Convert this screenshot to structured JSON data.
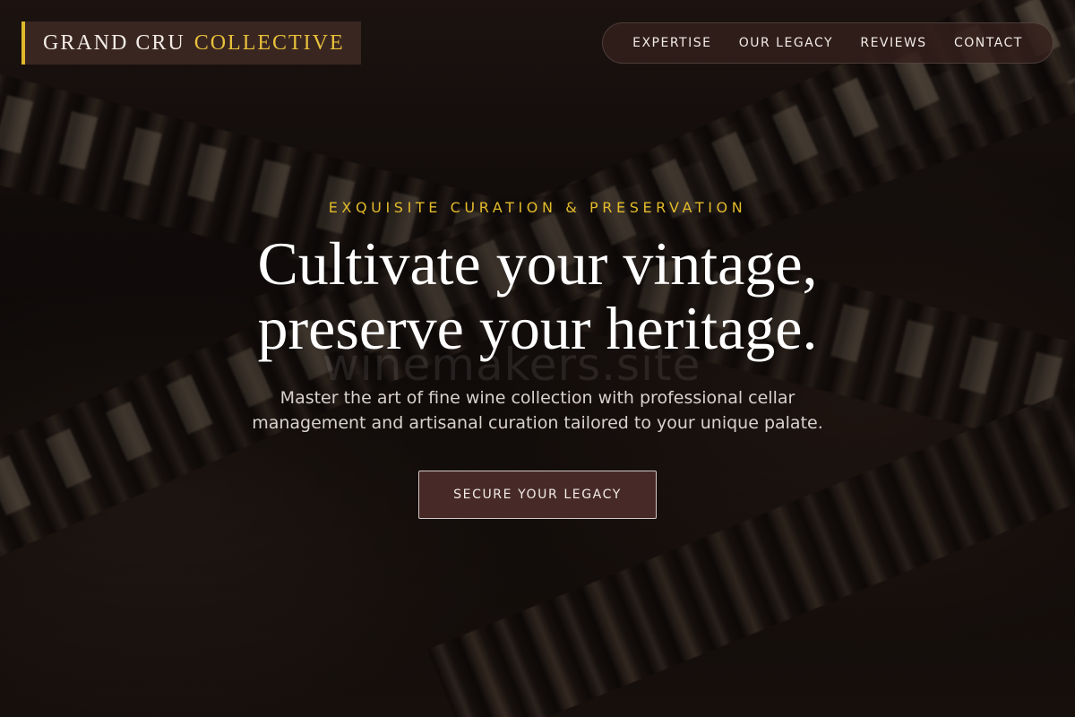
{
  "brand": {
    "name_main": "GRAND CRU",
    "name_accent": "COLLECTIVE",
    "accent_color": "#e8c13a"
  },
  "nav": {
    "items": [
      {
        "label": "EXPERTISE"
      },
      {
        "label": "OUR LEGACY"
      },
      {
        "label": "REVIEWS"
      },
      {
        "label": "CONTACT"
      }
    ]
  },
  "hero": {
    "eyebrow": "EXQUISITE CURATION & PRESERVATION",
    "headline_line1": "Cultivate your vintage,",
    "headline_line2": "preserve your heritage.",
    "subtext": "Master the art of fine wine collection with professional cellar management and artisanal curation tailored to your unique palate.",
    "cta_label": "SECURE YOUR LEGACY",
    "watermark": "winemakers.site"
  },
  "colors": {
    "gold": "#e3bb2b",
    "cta_bg": "#472a27",
    "nav_bg": "#34201c"
  }
}
